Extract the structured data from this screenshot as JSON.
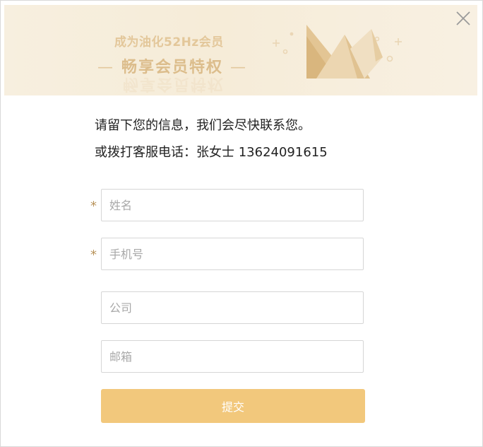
{
  "banner": {
    "line1": "成为油化52Hz会员",
    "line2": "畅享会员特权",
    "dash": "—"
  },
  "close": {
    "icon": "close-icon",
    "symbol": "✕"
  },
  "info": {
    "line1": "请留下您的信息，我们会尽快联系您。",
    "line2": "或拨打客服电话：张女士 13624091615"
  },
  "form": {
    "required_mark": "*",
    "name": {
      "value": "",
      "placeholder": "姓名",
      "required": true
    },
    "phone": {
      "value": "",
      "placeholder": "手机号",
      "required": true
    },
    "company": {
      "value": "",
      "placeholder": "公司",
      "required": false
    },
    "email": {
      "value": "",
      "placeholder": "邮箱",
      "required": false
    },
    "submit_label": "提交"
  },
  "colors": {
    "accent": "#f2c87c",
    "banner_bg": "#f7efdf",
    "required": "#b8935a"
  }
}
